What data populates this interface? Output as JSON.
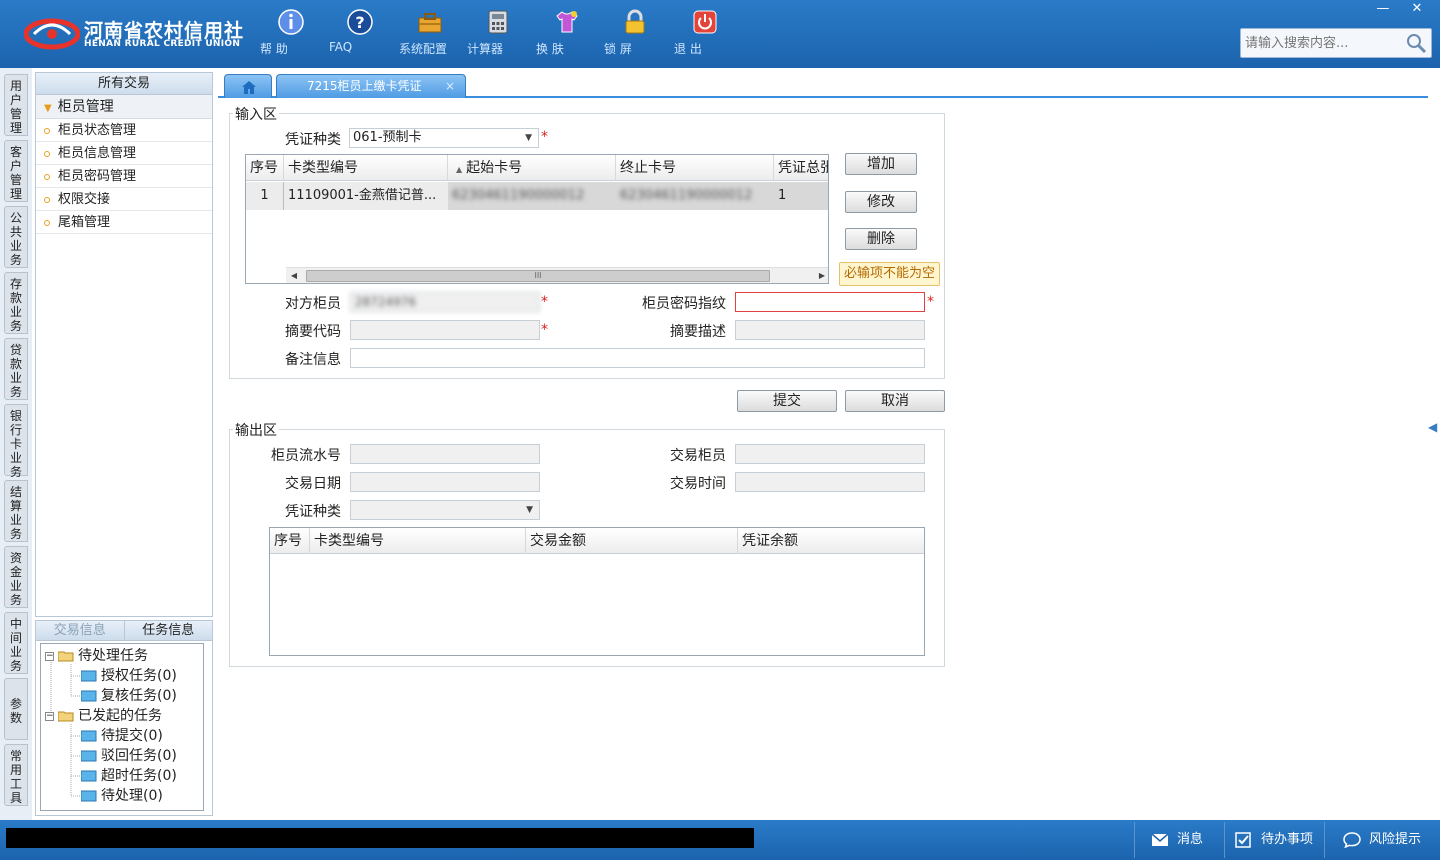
{
  "brand": {
    "name": "河南省农村信用社",
    "name_en": "HENAN RURAL CREDIT UNION"
  },
  "toolbar": [
    {
      "label": "帮 助",
      "icon": "info-icon"
    },
    {
      "label": "FAQ",
      "icon": "question-icon"
    },
    {
      "label": "系统配置",
      "icon": "toolbox-icon"
    },
    {
      "label": "计算器",
      "icon": "calculator-icon"
    },
    {
      "label": "换 肤",
      "icon": "shirt-icon"
    },
    {
      "label": "锁 屏",
      "icon": "lock-icon"
    },
    {
      "label": "退 出",
      "icon": "power-icon"
    }
  ],
  "window_controls": {
    "minimize": "—",
    "close": "✕"
  },
  "search": {
    "placeholder": "请输入搜索内容..."
  },
  "vtabs": [
    "用户管理",
    "客户管理",
    "公共业务",
    "存款业务",
    "贷款业务",
    "银行卡业务",
    "结算业务",
    "资金业务",
    "中间业务",
    "参数",
    "常用工具"
  ],
  "nav": {
    "header": "所有交易",
    "group": "柜员管理",
    "items": [
      "柜员状态管理",
      "柜员信息管理",
      "柜员密码管理",
      "权限交接",
      "尾箱管理"
    ]
  },
  "tasks": {
    "tabs": [
      "交易信息",
      "任务信息"
    ],
    "tree": {
      "pending": "待处理任务",
      "pending_children": [
        "授权任务(0)",
        "复核任务(0)"
      ],
      "initiated": "已发起的任务",
      "initiated_children": [
        "待提交(0)",
        "驳回任务(0)",
        "超时任务(0)",
        "待处理(0)"
      ]
    }
  },
  "tabs": {
    "active": "7215柜员上缴卡凭证",
    "close": "×"
  },
  "input_area": {
    "legend": "输入区",
    "voucher_type_label": "凭证种类",
    "voucher_type_value": "061-预制卡",
    "required_mark": "*",
    "grid": {
      "columns": [
        "序号",
        "卡类型编号",
        "起始卡号",
        "终止卡号",
        "凭证总张"
      ],
      "rows": [
        {
          "index": "1",
          "card_type": "11109001-金燕借记普...",
          "start_no": "6230461190000012",
          "end_no": "6230461190000012",
          "count": "1"
        }
      ],
      "scroll_mark": "III"
    },
    "buttons": {
      "add": "增加",
      "edit": "修改",
      "delete": "删除"
    },
    "tooltip": "必输项不能为空",
    "counterparty_label": "对方柜员",
    "counterparty_value": "28724976",
    "password_label": "柜员密码指纹",
    "summary_code_label": "摘要代码",
    "summary_desc_label": "摘要描述",
    "remark_label": "备注信息"
  },
  "actions": {
    "submit": "提交",
    "cancel": "取消"
  },
  "output_area": {
    "legend": "输出区",
    "serial_label": "柜员流水号",
    "teller_label": "交易柜员",
    "date_label": "交易日期",
    "time_label": "交易时间",
    "voucher_type_label": "凭证种类",
    "grid_columns": [
      "序号",
      "卡类型编号",
      "交易金额",
      "凭证余额"
    ]
  },
  "statusbar": {
    "message": "消息",
    "todo": "待办事项",
    "risk": "风险提示"
  },
  "colors": {
    "header": "#1c63ad",
    "accent": "#3a8ee0",
    "error": "#e04040"
  }
}
